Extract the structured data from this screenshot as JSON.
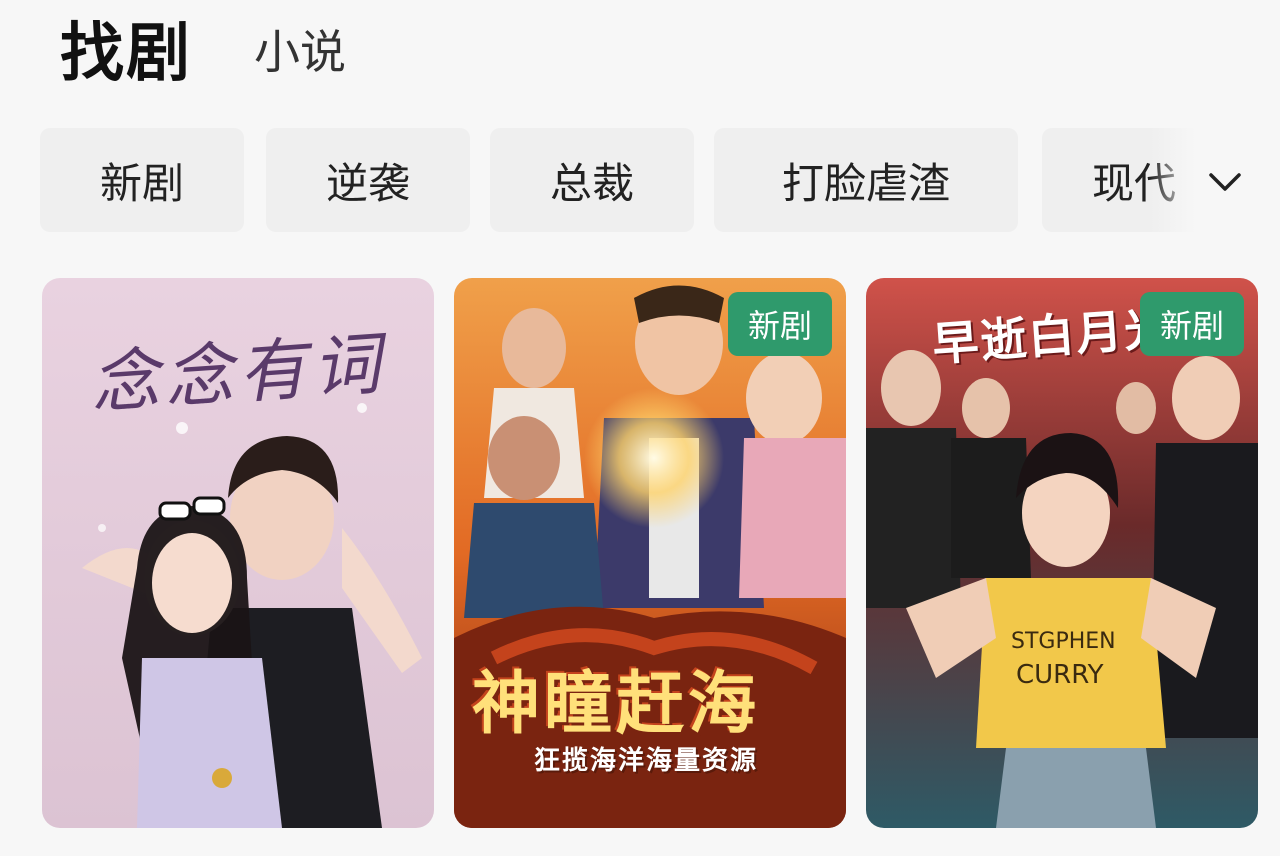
{
  "tabs": {
    "active": "找剧",
    "other": "小说"
  },
  "categories": [
    "新剧",
    "逆袭",
    "总裁",
    "打脸虐渣",
    "现代"
  ],
  "icons": {
    "expand": "chevron-down-icon"
  },
  "cards": [
    {
      "poster_title": "念念有词",
      "poster_subtitle": "",
      "badge": ""
    },
    {
      "poster_title": "神瞳赶海",
      "poster_subtitle": "狂揽海洋海量资源",
      "badge": "新剧"
    },
    {
      "poster_title": "早逝白月光",
      "poster_subtitle": "",
      "badge": "新剧"
    }
  ],
  "colors": {
    "badge": "#2f9a6c",
    "card1_bg": "#e6cfdc",
    "card2_bg": "#e8782a",
    "card3_bg": "#c9463a"
  }
}
